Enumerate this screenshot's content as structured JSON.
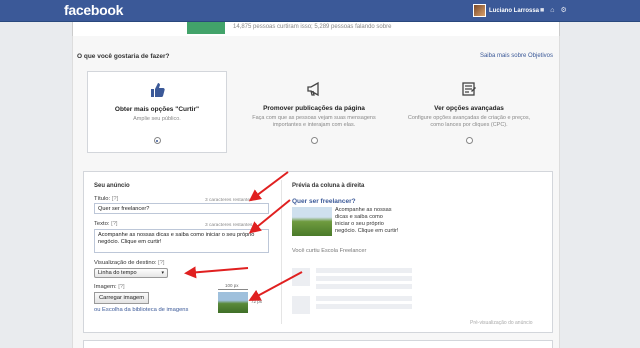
{
  "topbar": {
    "logo": "facebook",
    "user_name": "Luciano Larrossa",
    "icons": [
      "friend-requests-icon",
      "home-icon",
      "settings-icon"
    ]
  },
  "strip": {
    "text": "14,875 pessoas curtiram isso; 5,289 pessoas falando sobre"
  },
  "objective": {
    "question": "O que você gostaria de fazer?",
    "learn_more": "Saiba mais sobre Objetivos",
    "options": [
      {
        "icon": "thumbs-up-icon",
        "title": "Obter mais opções \"Curtir\"",
        "desc": "Amplie seu público.",
        "selected": true
      },
      {
        "icon": "megaphone-icon",
        "title": "Promover publicações da página",
        "desc": "Faça com que as pessoas vejam suas mensagens importantes e interajam com elas.",
        "selected": false
      },
      {
        "icon": "advanced-options-icon",
        "title": "Ver opções avançadas",
        "desc": "Configure opções avançadas de criação e preços, como lances por cliques (CPC).",
        "selected": false
      }
    ]
  },
  "ad": {
    "section_title": "Seu anúncio",
    "title_label": "Título:",
    "help_mark": "[?]",
    "title_chars": "3 caracteres restantes",
    "title_value": "Quer ser freelancer?",
    "text_label": "Texto:",
    "text_chars": "3 caracteres restantes",
    "text_value": "Acompanhe as nossas dicas e saiba como iniciar o seu próprio negócio. Clique em curtir!",
    "destination_label": "Visualização de destino:",
    "destination_value": "Linha do tempo",
    "image_label": "Imagem:",
    "upload_button": "Carregar imagem",
    "library_link": "ou Escolha da biblioteca de imagens",
    "width_dim": "100 px",
    "height_dim": "72 px"
  },
  "preview": {
    "section_title": "Prévia da coluna à direita",
    "ad_title": "Quer ser freelancer?",
    "ad_text": "Acompanhe as nossas dicas e saiba como iniciar o seu próprio negócio. Clique em curtir!",
    "liked_text": "Você curtiu Escola Freelancer",
    "footer": "Pré-visualização do anúncio"
  },
  "colors": {
    "brand": "#3b5998",
    "annotation_arrow": "#e02020"
  }
}
